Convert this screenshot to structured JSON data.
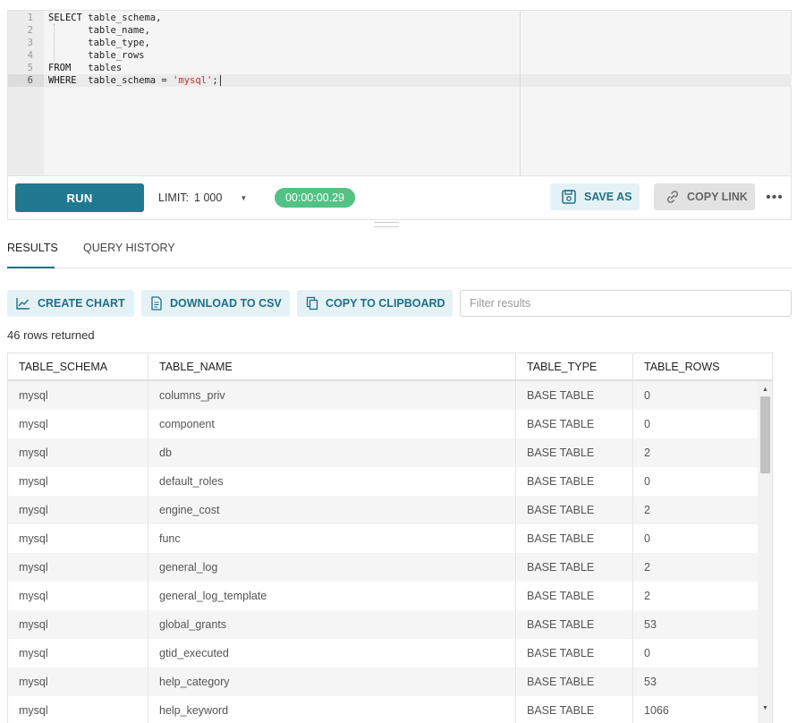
{
  "editor": {
    "line_numbers": [
      "1",
      "2",
      "3",
      "4",
      "5",
      "6"
    ],
    "lines": [
      {
        "kw": "SELECT",
        "rest": " table_schema,"
      },
      {
        "kw": "",
        "rest": "       table_name,"
      },
      {
        "kw": "",
        "rest": "       table_type,"
      },
      {
        "kw": "",
        "rest": "       table_rows"
      },
      {
        "kw": "FROM",
        "rest": "   tables"
      },
      {
        "kw": "WHERE",
        "rest": "  table_schema = ",
        "str": "'mysql'",
        "tail": ";"
      }
    ]
  },
  "toolbar": {
    "run_label": "RUN",
    "limit_label": "LIMIT:",
    "limit_value": "1 000",
    "timer": "00:00:00.29",
    "save_as_label": "SAVE AS",
    "copy_link_label": "COPY LINK",
    "more_label": "•••"
  },
  "tabs": {
    "results": "RESULTS",
    "history": "QUERY HISTORY"
  },
  "actions": {
    "create_chart": "CREATE CHART",
    "download_csv": "DOWNLOAD TO CSV",
    "copy_clipboard": "COPY TO CLIPBOARD",
    "filter_placeholder": "Filter results"
  },
  "rows_returned": "46 rows returned",
  "table": {
    "columns": [
      "TABLE_SCHEMA",
      "TABLE_NAME",
      "TABLE_TYPE",
      "TABLE_ROWS"
    ],
    "rows": [
      [
        "mysql",
        "columns_priv",
        "BASE TABLE",
        "0"
      ],
      [
        "mysql",
        "component",
        "BASE TABLE",
        "0"
      ],
      [
        "mysql",
        "db",
        "BASE TABLE",
        "2"
      ],
      [
        "mysql",
        "default_roles",
        "BASE TABLE",
        "0"
      ],
      [
        "mysql",
        "engine_cost",
        "BASE TABLE",
        "2"
      ],
      [
        "mysql",
        "func",
        "BASE TABLE",
        "0"
      ],
      [
        "mysql",
        "general_log",
        "BASE TABLE",
        "2"
      ],
      [
        "mysql",
        "general_log_template",
        "BASE TABLE",
        "2"
      ],
      [
        "mysql",
        "global_grants",
        "BASE TABLE",
        "53"
      ],
      [
        "mysql",
        "gtid_executed",
        "BASE TABLE",
        "0"
      ],
      [
        "mysql",
        "help_category",
        "BASE TABLE",
        "53"
      ],
      [
        "mysql",
        "help_keyword",
        "BASE TABLE",
        "1066"
      ]
    ]
  },
  "colors": {
    "primary": "#1f7a91",
    "timer_green": "#52c285",
    "action_bg": "#e4f2f6",
    "string_red": "#c22d2d"
  },
  "icons": {
    "save": "save-icon",
    "link": "link-icon",
    "chart": "chart-icon",
    "document": "document-icon",
    "copy": "copy-icon"
  }
}
